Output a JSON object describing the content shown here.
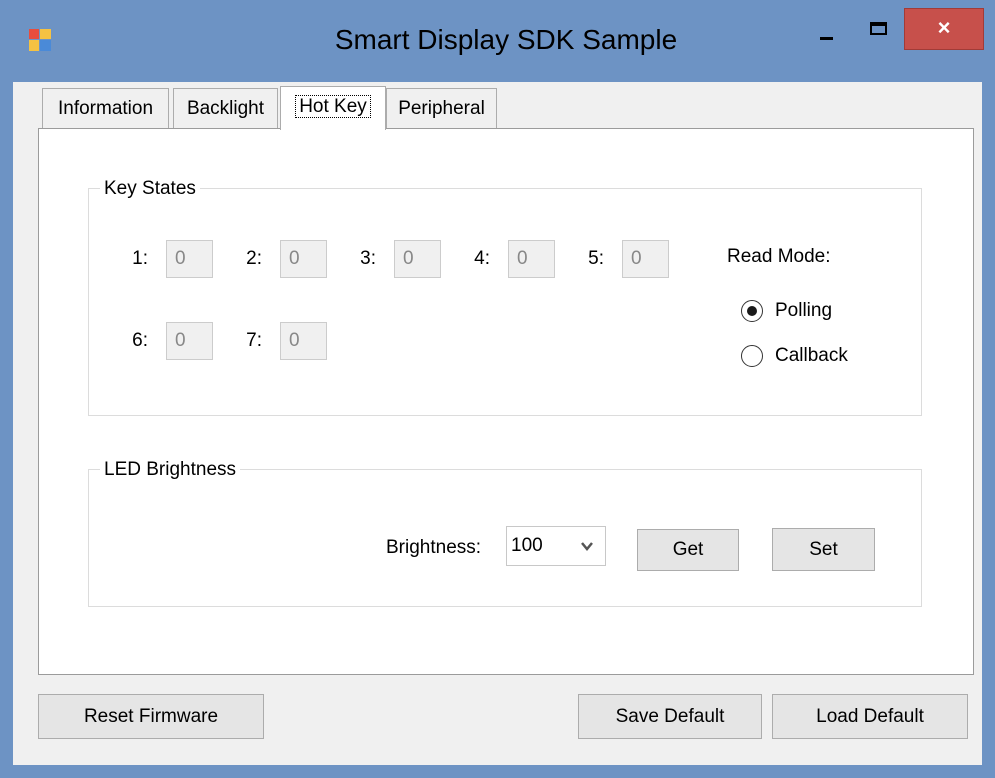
{
  "window": {
    "title": "Smart Display SDK Sample",
    "close_glyph": "×"
  },
  "tabs": [
    {
      "label": "Information"
    },
    {
      "label": "Backlight"
    },
    {
      "label": "Hot Key"
    },
    {
      "label": "Peripheral"
    }
  ],
  "active_tab": "Hot Key",
  "key_states": {
    "title": "Key States",
    "keys": [
      {
        "label": "1:",
        "value": "0"
      },
      {
        "label": "2:",
        "value": "0"
      },
      {
        "label": "3:",
        "value": "0"
      },
      {
        "label": "4:",
        "value": "0"
      },
      {
        "label": "5:",
        "value": "0"
      },
      {
        "label": "6:",
        "value": "0"
      },
      {
        "label": "7:",
        "value": "0"
      }
    ],
    "read_mode": {
      "label": "Read Mode:",
      "options": [
        "Polling",
        "Callback"
      ],
      "selected": "Polling"
    }
  },
  "led_brightness": {
    "title": "LED Brightness",
    "brightness_label": "Brightness:",
    "brightness_value": "100",
    "get_label": "Get",
    "set_label": "Set"
  },
  "footer": {
    "reset_label": "Reset Firmware",
    "save_label": "Save Default",
    "load_label": "Load Default"
  },
  "icons": {
    "app": "app-window-icon",
    "minimize": "minimize-icon",
    "maximize": "maximize-icon",
    "close": "close-icon",
    "dropdown": "chevron-down-icon"
  },
  "colors": {
    "titlebar": "#6d93c4",
    "close_button": "#c7504b",
    "client": "#f0f0f0"
  }
}
